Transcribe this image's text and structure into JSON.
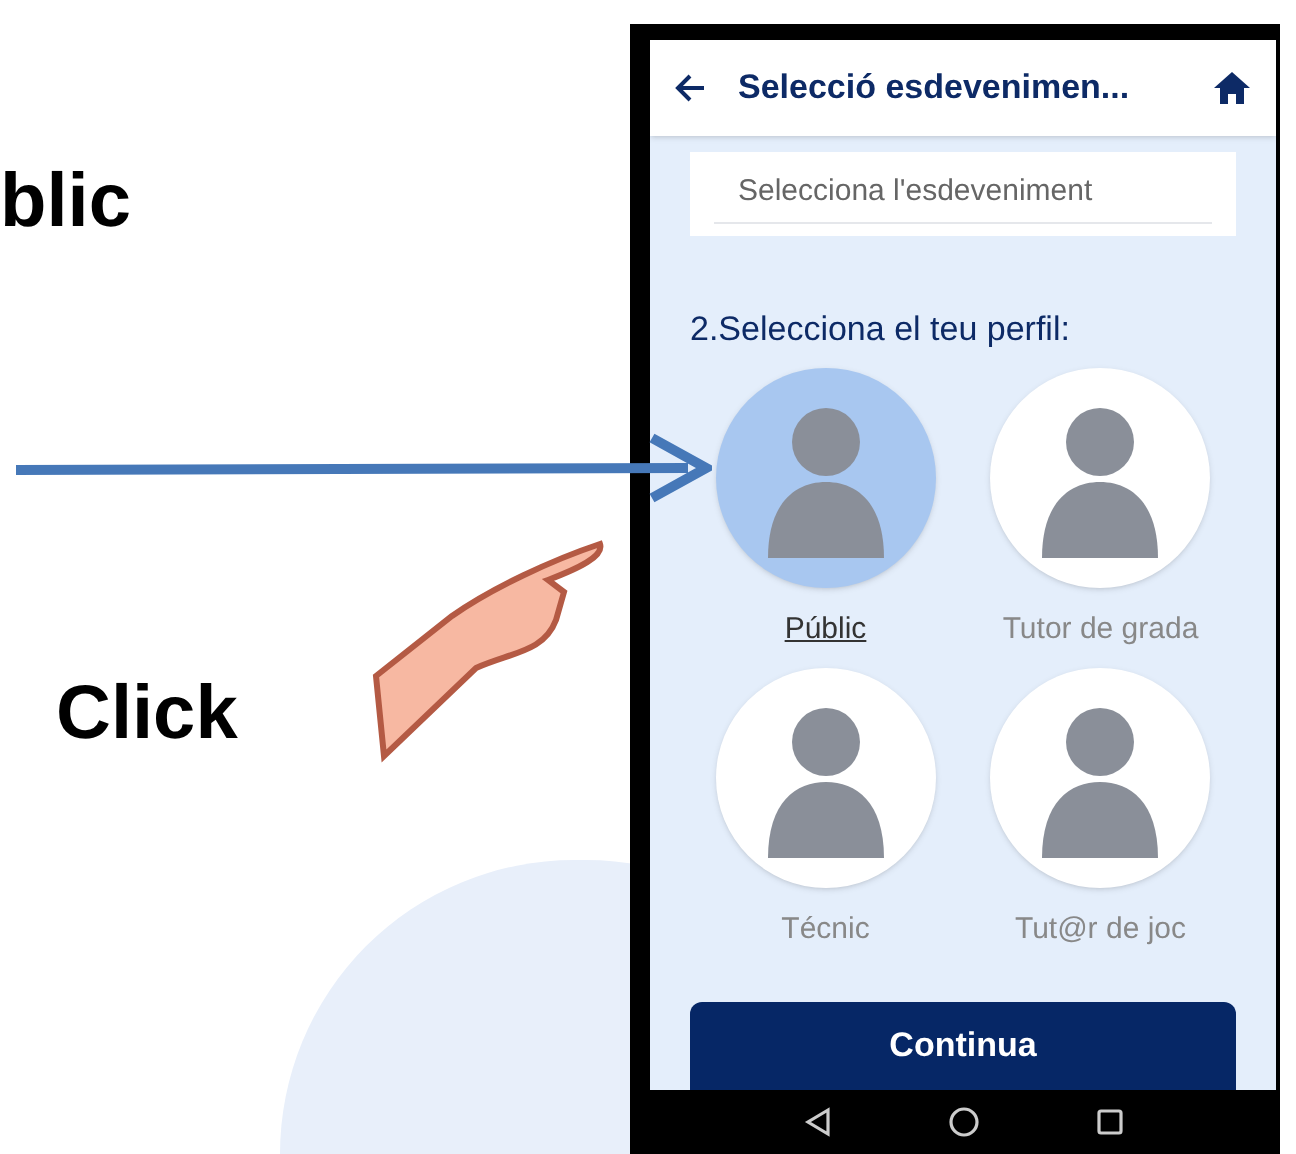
{
  "slide": {
    "heading": "blic",
    "caption": "Click"
  },
  "app": {
    "title": "Selecció esdevenimen...",
    "event_field": {
      "placeholder": "Selecciona l'esdeveniment"
    },
    "section_label": "2.Selecciona el teu perfil:",
    "profiles": [
      {
        "label": "Públic",
        "selected": true
      },
      {
        "label": "Tutor de grada",
        "selected": false
      },
      {
        "label": "Técnic",
        "selected": false
      },
      {
        "label": "Tut@r de joc",
        "selected": false
      }
    ],
    "continue_button": "Continua"
  }
}
